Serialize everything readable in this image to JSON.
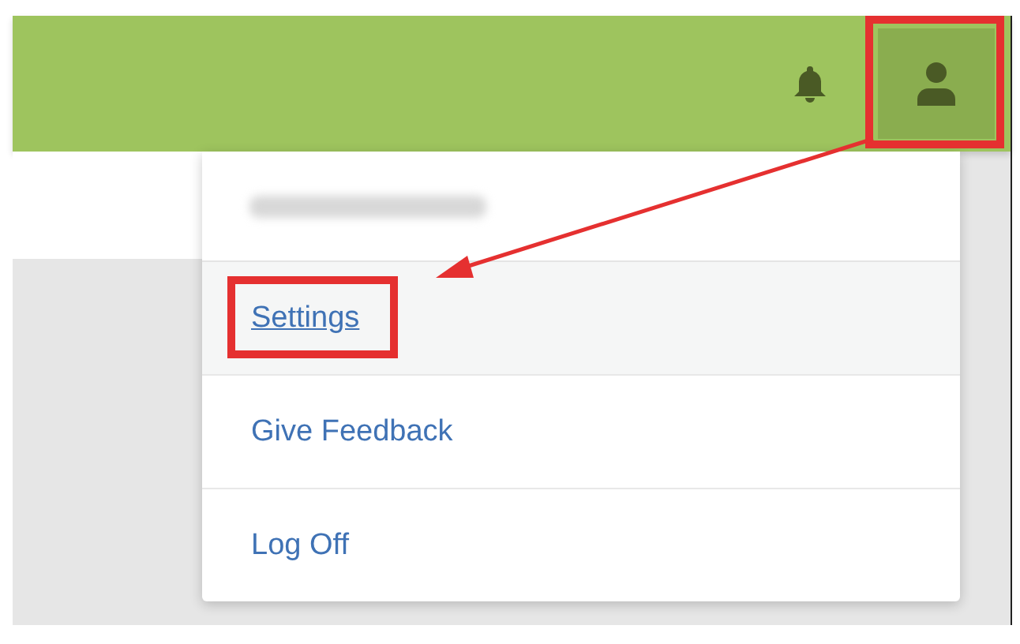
{
  "user_menu": {
    "open": true,
    "redacted_name": true,
    "items": [
      {
        "label": "Settings",
        "selected": true,
        "highlighted": true
      },
      {
        "label": "Give Feedback",
        "selected": false,
        "highlighted": false
      },
      {
        "label": "Log Off",
        "selected": false,
        "highlighted": false
      }
    ]
  },
  "annotations": {
    "highlight_user_button": true
  }
}
